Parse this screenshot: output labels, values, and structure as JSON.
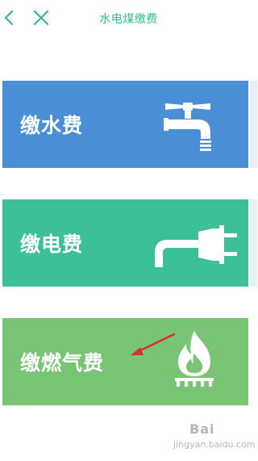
{
  "header": {
    "title": "水电煤缴费",
    "back_icon": "chevron-left-icon",
    "close_icon": "close-icon",
    "accent_color": "#2dbb96"
  },
  "cards": [
    {
      "label": "缴水费",
      "icon": "water-faucet-icon",
      "color": "#4a8ed5"
    },
    {
      "label": "缴电费",
      "icon": "power-plug-icon",
      "color": "#3dbf98"
    },
    {
      "label": "缴燃气费",
      "icon": "gas-flame-icon",
      "color": "#79c575"
    }
  ],
  "annotation": {
    "arrow_color": "#d93030"
  },
  "watermark": {
    "brand": "Bai",
    "url": "jingyan.baidu.com"
  }
}
